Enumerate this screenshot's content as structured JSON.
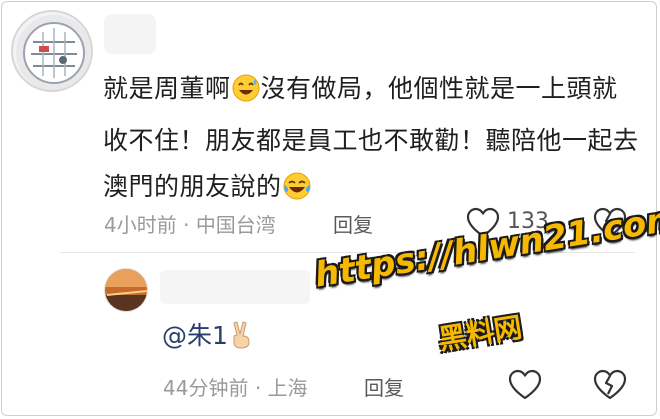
{
  "comment1": {
    "text_part1": "就是周董啊",
    "text_part2": "沒有做局，他個性就是一上頭就收不住！朋友都是員工也不敢勸！聽陪他一起去澳門的朋友說的",
    "time": "4小时前",
    "location": "中国台湾",
    "reply_label": "回复",
    "like_count": "133"
  },
  "comment2": {
    "text": "@朱1",
    "time": "44分钟前",
    "location": "上海",
    "reply_label": "回复"
  },
  "watermark": {
    "url": "https://hlwn21.com",
    "name": "黑料网"
  },
  "colors": {
    "watermark_fill": "#f6b800",
    "mention_color": "#28406b",
    "meta_gray": "#9a9a9a"
  },
  "icons": [
    "heart-outline-icon",
    "broken-heart-icon",
    "sweat-smile-emoji",
    "tears-of-joy-emoji",
    "victory-hand-emoji"
  ]
}
